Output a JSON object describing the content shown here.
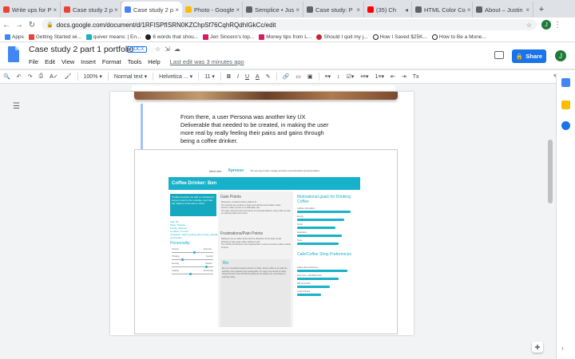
{
  "browser": {
    "tabs": [
      {
        "label": "Write ups for P",
        "color": "#ea4335"
      },
      {
        "label": "Case study 2 p",
        "color": "#ea4335"
      },
      {
        "label": "Case study 2 p",
        "color": "#4285f4"
      },
      {
        "label": "Photo - Google",
        "color": "#fbbc04"
      },
      {
        "label": "Semplice • Jus",
        "color": "#5f6368"
      },
      {
        "label": "Case study: P",
        "color": "#5f6368"
      },
      {
        "label": "(35) Ch",
        "color": "#ff0000"
      },
      {
        "label": "HTML Color Co",
        "color": "#5f6368"
      },
      {
        "label": "About – Justin",
        "color": "#5f6368"
      }
    ],
    "url": "docs.google.com/document/d/1RFISPfISRN0KZChpSf76CqhRQdhIGkCc/edit",
    "profile_initial": "J",
    "bookmarks": [
      {
        "label": "Apps",
        "color": "#4285f4"
      },
      {
        "label": "Getting Started wi...",
        "color": "#ea4335"
      },
      {
        "label": "quiver means: | En...",
        "color": "#17b1c9"
      },
      {
        "label": "6 words that shou...",
        "color": "#202124"
      },
      {
        "label": "Jen Sincero's top...",
        "color": "#d81b60"
      },
      {
        "label": "Money tips from L...",
        "color": "#d81b60"
      },
      {
        "label": "Should I quit my j...",
        "color": "#c62828"
      },
      {
        "label": "How I Saved $25K...",
        "color": "#202124"
      },
      {
        "label": "How to Be a Mone...",
        "color": "#202124"
      }
    ]
  },
  "docs": {
    "title": "Case study 2 part 1 portfolio",
    "format_badge": "DOCX",
    "menus": [
      "File",
      "Edit",
      "View",
      "Insert",
      "Format",
      "Tools",
      "Help"
    ],
    "last_edit": "Last edit was 3 minutes ago",
    "share_label": "Share",
    "user_initial": "J",
    "toolbar": {
      "zoom": "100%",
      "style": "Normal text",
      "font": "Helvetica ...",
      "size": "11"
    }
  },
  "document": {
    "paragraph": "From there, a user Persona was another key UX Deliverable that needed to be created, in making the user more real by really feeling their pains and gains through being a coffee drinker.",
    "persona": {
      "header_text": "Meet the",
      "header_logo": "Xpresso",
      "header_tag": "The new way to order, manage and share visual information and presentations",
      "banner": "Coffee Drinker: Ben",
      "quote": "\"Coffee provides me with a motivational surge to start to the workday, and I like the caffeine it has when I drink.\"",
      "info": [
        "Age: 35",
        "Work: Teacher",
        "Family: Married",
        "Location: Cornell",
        "Character: Hard working with a lively, friendly personality"
      ],
      "personality_title": "Personality",
      "sliders": [
        {
          "left": "Introvert",
          "right": "Extrovert",
          "value": 0.55
        },
        {
          "left": "Thinking",
          "right": "Feeling",
          "value": 0.25
        },
        {
          "left": "Sensing",
          "right": "Intuition",
          "value": 0.85
        },
        {
          "left": "Judging",
          "right": "Perceiving",
          "value": 0.45
        }
      ],
      "gain_title": "Gain Points",
      "gain_points": [
        "Reassures, consistent with a caffeine fix",
        "The benefits are excellent to begin and uphold concentration coffee",
        "Delivers coffee service to an affordable rate",
        "The taste, fast and real convenience of receiving delicious, tasty coffee as well as ordering coffee from home"
      ],
      "pain_title": "Frustrations/Pain Points",
      "pain_points": [
        "Waiting in line at coffee shops with the distraction of the large crowd",
        "Website for take away coffee lacking to visit",
        "The COVID-19 Pandemic has impacted Ben's need to consume coffee outside of home"
      ],
      "bio_title": "Bio",
      "bio_text": "Ben is a constantly frequent drinker of coffee, whose coffee is to make his workday more pleasant and manageable. He enjoys the benefit of coffee shops but due to the COVID-19 pandemic his options are now limited to ordering online.",
      "goals_title": "Motivational goals for Drinking Coffee",
      "goals": [
        {
          "label": "Caffeine Stimulation",
          "value": 0.9
        },
        {
          "label": "Energy",
          "value": 0.8
        },
        {
          "label": "Social",
          "value": 0.65
        },
        {
          "label": "Relaxation",
          "value": 0.75
        },
        {
          "label": "Taste",
          "value": 0.7
        }
      ],
      "pref_title": "Cafe/Coffee Shop Preferences",
      "prefs": [
        {
          "label": "Coffee taste preference",
          "value": 0.85
        },
        {
          "label": "Price level - affordable shop",
          "value": 0.7
        },
        {
          "label": "Wifi connection",
          "value": 0.55
        },
        {
          "label": "Loyal to Brand",
          "value": 0.4
        }
      ]
    }
  }
}
